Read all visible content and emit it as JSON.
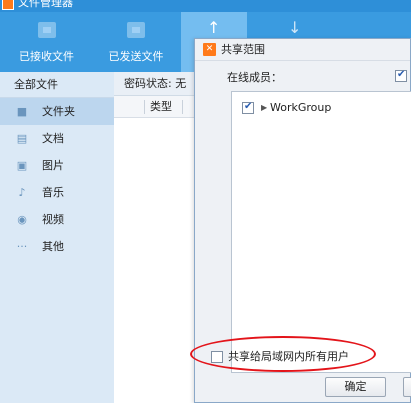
{
  "window": {
    "title": "文件管理器"
  },
  "toolbar": {
    "received": "已接收文件",
    "sent": "已发送文件"
  },
  "sidebar": {
    "header": "全部文件",
    "items": [
      {
        "label": "文件夹",
        "icon": "folder-icon"
      },
      {
        "label": "文档",
        "icon": "document-icon"
      },
      {
        "label": "图片",
        "icon": "image-icon"
      },
      {
        "label": "音乐",
        "icon": "music-icon"
      },
      {
        "label": "视频",
        "icon": "video-icon"
      },
      {
        "label": "其他",
        "icon": "more-icon"
      }
    ]
  },
  "content": {
    "password_status": "密码状态: 无",
    "col_type": "类型"
  },
  "dialog": {
    "title": "共享范围",
    "members_label": "在线成员：",
    "tree": [
      {
        "label": "WorkGroup",
        "checked": true
      }
    ],
    "share_all_label": "共享给局域网内所有用户",
    "share_all_checked": false,
    "ok_label": "确定"
  },
  "colors": {
    "toolbar": "#3a9be0",
    "sidebar": "#dbe9f6",
    "highlight": "#e3141a",
    "logo": "#ff7a1a"
  }
}
